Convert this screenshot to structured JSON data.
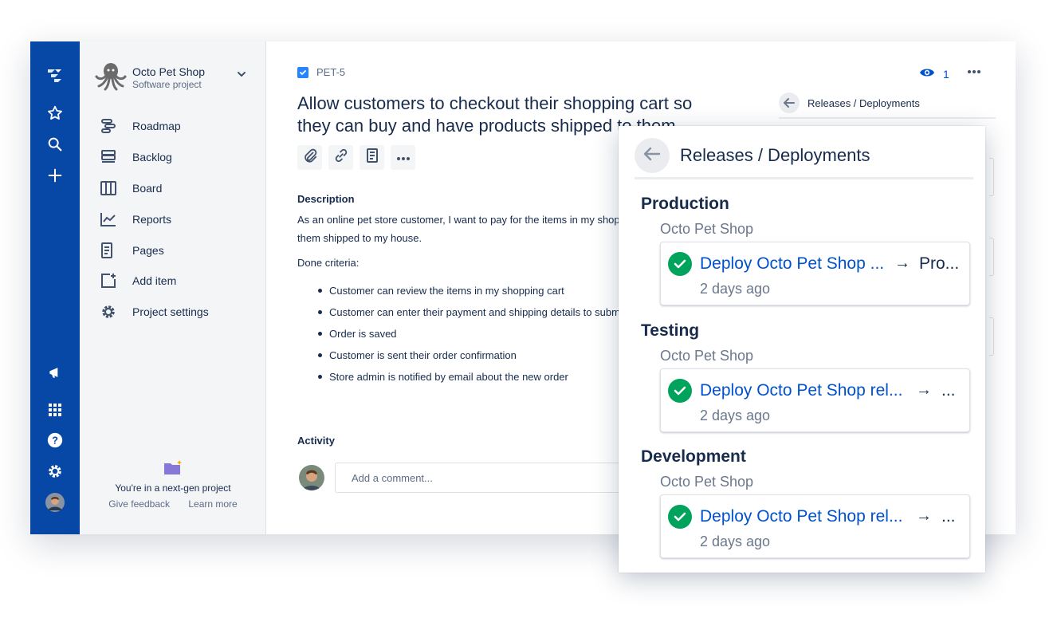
{
  "colors": {
    "global_nav": "#0747a6",
    "link": "#0052cc",
    "success": "#00a35c",
    "text": "#172b4d"
  },
  "global_nav": {
    "icons": [
      "jira-logo-icon",
      "star-icon",
      "search-icon",
      "plus-icon",
      "megaphone-icon",
      "app-switcher-icon",
      "help-icon",
      "settings-icon",
      "user-avatar"
    ]
  },
  "sidebar": {
    "project_name": "Octo Pet Shop",
    "project_type": "Software project",
    "items": [
      {
        "label": "Roadmap",
        "icon": "roadmap-icon"
      },
      {
        "label": "Backlog",
        "icon": "backlog-icon"
      },
      {
        "label": "Board",
        "icon": "board-icon"
      },
      {
        "label": "Reports",
        "icon": "reports-icon"
      },
      {
        "label": "Pages",
        "icon": "pages-icon"
      },
      {
        "label": "Add item",
        "icon": "add-item-icon"
      },
      {
        "label": "Project settings",
        "icon": "gear-icon"
      }
    ],
    "footer_message": "You're in a next-gen project",
    "give_feedback": "Give feedback",
    "learn_more": "Learn more"
  },
  "issue": {
    "key": "PET-5",
    "title": "Allow customers to checkout their shopping cart so they can buy and have products shipped to them",
    "watchers": "1",
    "description_heading": "Description",
    "description": "As an online pet store customer, I want to pay for the items in my shop them shipped to my house.",
    "description_line1": "As an online pet store customer, I want to pay for the items in my shop",
    "description_line2": "them shipped to my house.",
    "done_criteria": "Done criteria:",
    "criteria": [
      "Customer can review the items in my shopping cart",
      "Customer can enter their payment and shipping details to subm",
      "Order is saved",
      "Customer is sent their order confirmation",
      "Store admin is notified by email about the new order"
    ],
    "activity_heading": "Activity",
    "comment_placeholder": "Add a comment..."
  },
  "releases_panel": {
    "title": "Releases / Deployments"
  },
  "popup": {
    "title": "Releases / Deployments",
    "environments": [
      {
        "name": "Production",
        "project": "Octo Pet Shop",
        "deployment": "Deploy Octo Pet Shop ...",
        "target": "Pro...",
        "time": "2 days ago"
      },
      {
        "name": "Testing",
        "project": "Octo Pet Shop",
        "deployment": "Deploy Octo Pet Shop rel...",
        "target": "...",
        "time": "2 days ago"
      },
      {
        "name": "Development",
        "project": "Octo Pet Shop",
        "deployment": "Deploy Octo Pet Shop rel...",
        "target": "...",
        "time": "2 days ago"
      }
    ]
  }
}
